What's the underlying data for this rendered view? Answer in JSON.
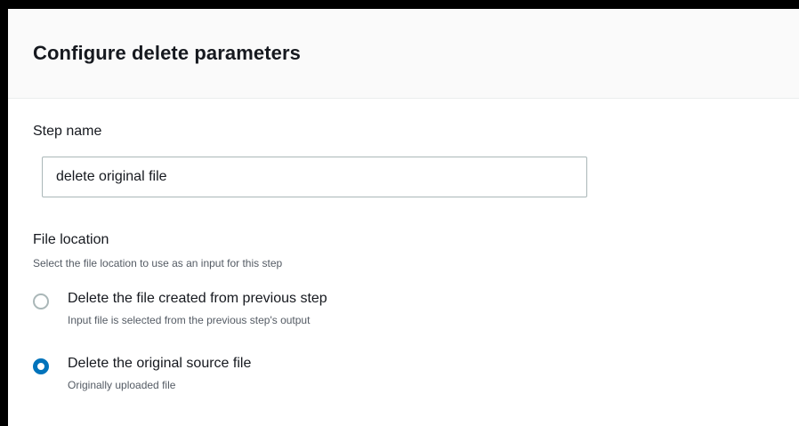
{
  "panel": {
    "title": "Configure delete parameters"
  },
  "step_name": {
    "label": "Step name",
    "value": "delete original file"
  },
  "file_location": {
    "label": "File location",
    "description": "Select the file location to use as an input for this step",
    "options": [
      {
        "label": "Delete the file created from previous step",
        "description": "Input file is selected from the previous step's output",
        "selected": false
      },
      {
        "label": "Delete the original source file",
        "description": "Originally uploaded file",
        "selected": true
      }
    ]
  },
  "colors": {
    "accent": "#0073bb",
    "text": "#16191f",
    "secondary_text": "#545b64",
    "border": "#aab7b8"
  }
}
